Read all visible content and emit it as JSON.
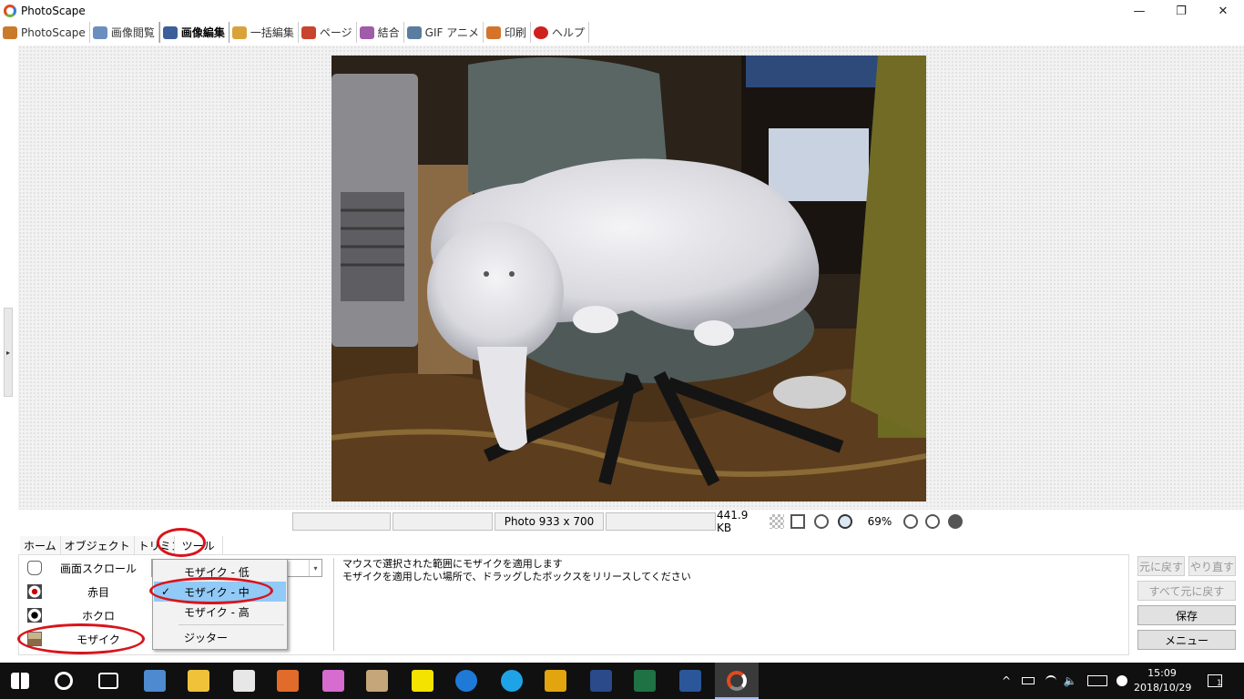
{
  "window": {
    "title": "PhotoScape",
    "minimize": "—",
    "maximize": "❐",
    "close": "✕"
  },
  "maintabs": [
    {
      "label": "PhotoScape",
      "color": "#c97b2b"
    },
    {
      "label": "画像閲覧",
      "color": "#6a8fbf"
    },
    {
      "label": "画像編集",
      "color": "#3b5f9a"
    },
    {
      "label": "一括編集",
      "color": "#d9a33a"
    },
    {
      "label": "ページ",
      "color": "#c9442c"
    },
    {
      "label": "結合",
      "color": "#a05ca8"
    },
    {
      "label": "GIF アニメ",
      "color": "#5a7d9f"
    },
    {
      "label": "印刷",
      "color": "#d4742a"
    },
    {
      "label": "ヘルプ",
      "color": "#d0201e"
    }
  ],
  "viewer": {
    "grip": "▸"
  },
  "status": {
    "box1": "",
    "box2": "",
    "dimensions": "Photo 933 x 700",
    "box4": "",
    "filesize": "441.9 KB",
    "zoom": "69%"
  },
  "subtabs": [
    "ホーム",
    "オブジェクト",
    "トリミング",
    "ツール"
  ],
  "tools": [
    {
      "label": "画面スクロール",
      "icon": "hand-icon"
    },
    {
      "label": "赤目",
      "icon": "red-eye-icon"
    },
    {
      "label": "ホクロ",
      "icon": "mole-icon"
    },
    {
      "label": "モザイク",
      "icon": "mosaic-icon"
    }
  ],
  "combo": {
    "arrow": "▾"
  },
  "dropdown": {
    "items": [
      "モザイク - 低",
      "モザイク - 中",
      "モザイク - 高",
      "ジッター"
    ],
    "selected": "モザイク - 中",
    "check": "✓"
  },
  "description": {
    "line1": "マウスで選択された範囲にモザイクを適用します",
    "line2": "モザイクを適用したい場所で、ドラッグしたボックスをリリースしてください"
  },
  "buttons": {
    "undo": "元に戻す",
    "redo": "やり直す",
    "undo_all": "すべて元に戻す",
    "save": "保存",
    "menu": "メニュー"
  },
  "taskbar": {
    "time": "15:09",
    "date": "2018/10/29",
    "notifications": "1",
    "tray_up": "^",
    "volume": "🔈"
  },
  "colors": {
    "highlight_red": "#d8141b",
    "selection_blue": "#91c9f7",
    "taskbar_bg": "#101010"
  }
}
